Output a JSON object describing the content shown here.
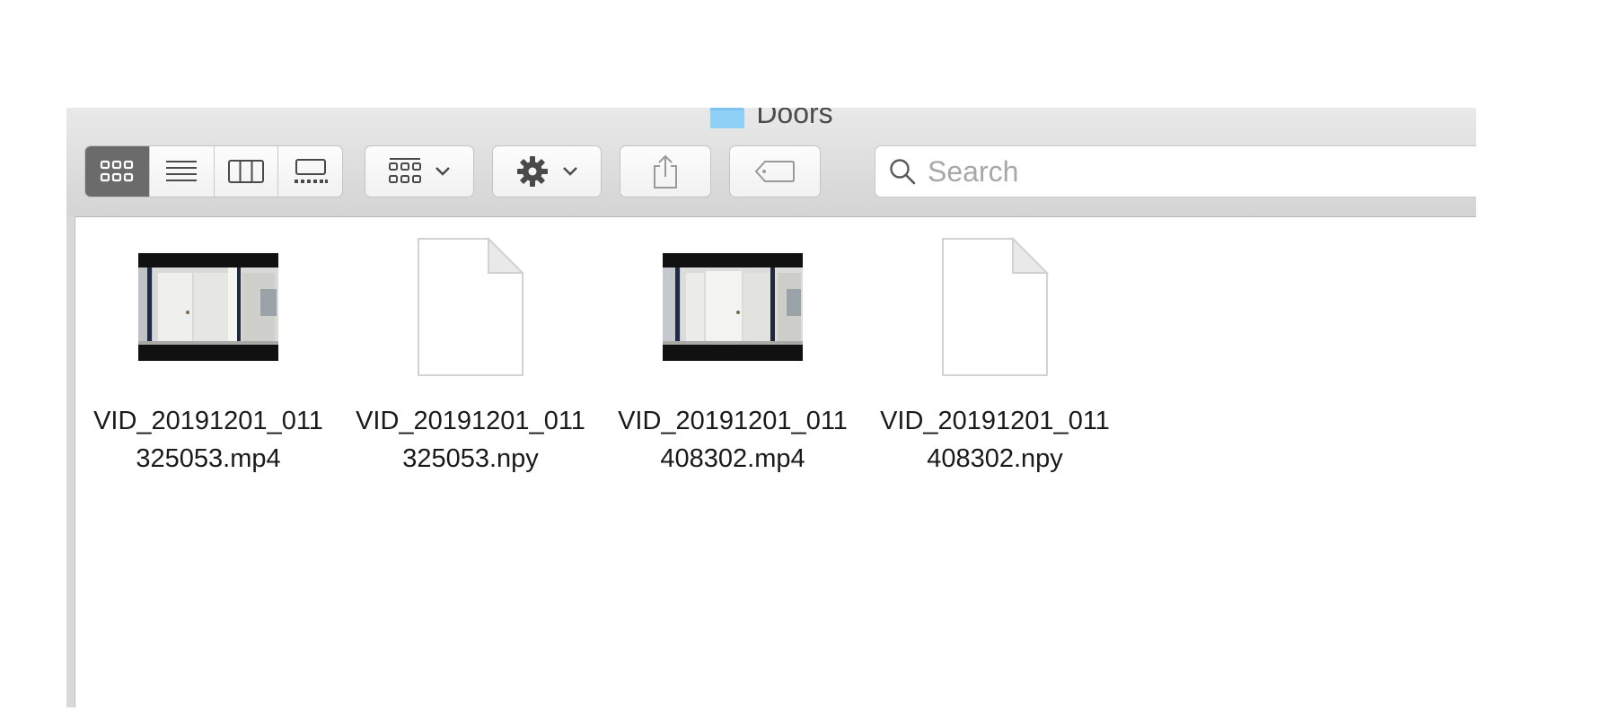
{
  "window": {
    "title": "Doors",
    "folder_icon": "folder-icon",
    "colors": {
      "folder": "#7cc3ef",
      "selected_view": "#6b6b6b",
      "toolbar": "#dcdcdc"
    }
  },
  "toolbar": {
    "view_modes": [
      {
        "name": "icon-view",
        "icon": "grid-icon",
        "selected": true
      },
      {
        "name": "list-view",
        "icon": "list-icon",
        "selected": false
      },
      {
        "name": "column-view",
        "icon": "columns-icon",
        "selected": false
      },
      {
        "name": "gallery-view",
        "icon": "gallery-icon",
        "selected": false
      }
    ],
    "group_button_icon": "group-grid-icon",
    "action_button_icon": "gear-icon",
    "share_button_icon": "share-icon",
    "tag_button_icon": "tag-icon",
    "search": {
      "placeholder": "Search",
      "icon": "search-icon"
    }
  },
  "files": [
    {
      "name_line1": "VID_20191201_011",
      "name_line2": "325053.mp4",
      "kind": "video"
    },
    {
      "name_line1": "VID_20191201_011",
      "name_line2": "325053.npy",
      "kind": "document"
    },
    {
      "name_line1": "VID_20191201_011",
      "name_line2": "408302.mp4",
      "kind": "video"
    },
    {
      "name_line1": "VID_20191201_011",
      "name_line2": "408302.npy",
      "kind": "document"
    }
  ]
}
